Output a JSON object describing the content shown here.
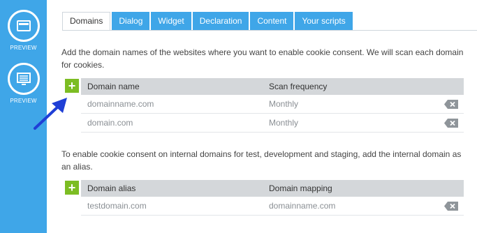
{
  "sidebar": {
    "preview1_label": "PREVIEW",
    "preview2_label": "PREVIEW"
  },
  "tabs": [
    "Domains",
    "Dialog",
    "Widget",
    "Declaration",
    "Content",
    "Your scripts"
  ],
  "domains": {
    "description": "Add the domain names of the websites where you want to enable cookie consent. We will scan each domain for cookies.",
    "headers": [
      "Domain name",
      "Scan frequency"
    ],
    "rows": [
      {
        "domain": "domainname.com",
        "frequency": "Monthly"
      },
      {
        "domain": "domain.com",
        "frequency": "Monthly"
      }
    ]
  },
  "aliases": {
    "description": "To enable cookie consent on internal domains for test, development and staging, add the internal domain as an alias.",
    "headers": [
      "Domain alias",
      "Domain mapping"
    ],
    "rows": [
      {
        "alias": "testdomain.com",
        "mapping": "domainname.com"
      }
    ]
  },
  "add_glyph": "+",
  "colors": {
    "sidebar": "#3fa6e8",
    "tab": "#3fa6e8",
    "add_button": "#7cbd23",
    "arrow": "#1f3fd6",
    "header_row": "#d4d7da"
  }
}
